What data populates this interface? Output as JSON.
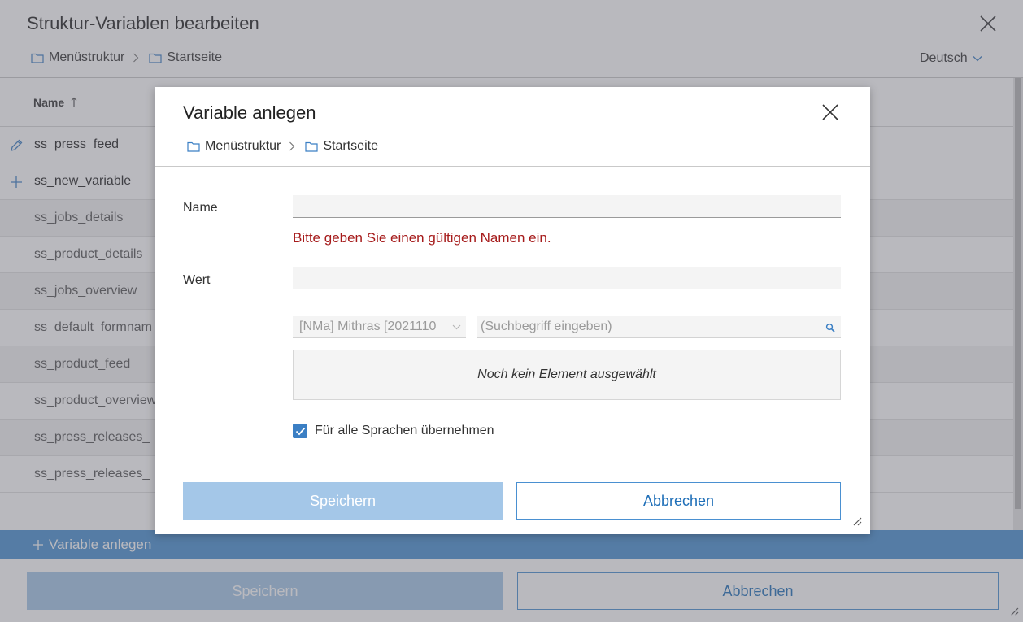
{
  "background": {
    "title": "Struktur-Variablen bearbeiten",
    "breadcrumb": [
      "Menüstruktur",
      "Startseite"
    ],
    "language": "Deutsch",
    "table": {
      "column_name": "Name",
      "rows": [
        {
          "name": "ss_press_feed",
          "icon": "pencil-icon"
        },
        {
          "name": "ss_new_variable",
          "icon": "plus-icon"
        },
        {
          "name": "ss_jobs_details"
        },
        {
          "name": "ss_product_details"
        },
        {
          "name": "ss_jobs_overview"
        },
        {
          "name": "ss_default_formnam"
        },
        {
          "name": "ss_product_feed"
        },
        {
          "name": "ss_product_overview"
        },
        {
          "name": "ss_press_releases_"
        },
        {
          "name": "ss_press_releases_"
        }
      ]
    },
    "add_variable_label": "Variable anlegen",
    "save_label": "Speichern",
    "cancel_label": "Abbrechen"
  },
  "dialog": {
    "title": "Variable anlegen",
    "breadcrumb": [
      "Menüstruktur",
      "Startseite"
    ],
    "name_label": "Name",
    "name_value": "",
    "name_error": "Bitte geben Sie einen gültigen Namen ein.",
    "value_label": "Wert",
    "value_value": "",
    "project_select": "[NMa] Mithras [2021110",
    "search_placeholder": "(Suchbegriff eingeben)",
    "empty_selection": "Noch kein Element ausgewählt",
    "apply_all_languages_label": "Für alle Sprachen übernehmen",
    "apply_all_languages_checked": true,
    "save_label": "Speichern",
    "cancel_label": "Abbrechen"
  },
  "colors": {
    "accent": "#4a90d1",
    "error": "#a61c1c",
    "disabled_button": "#a4c7e8"
  }
}
